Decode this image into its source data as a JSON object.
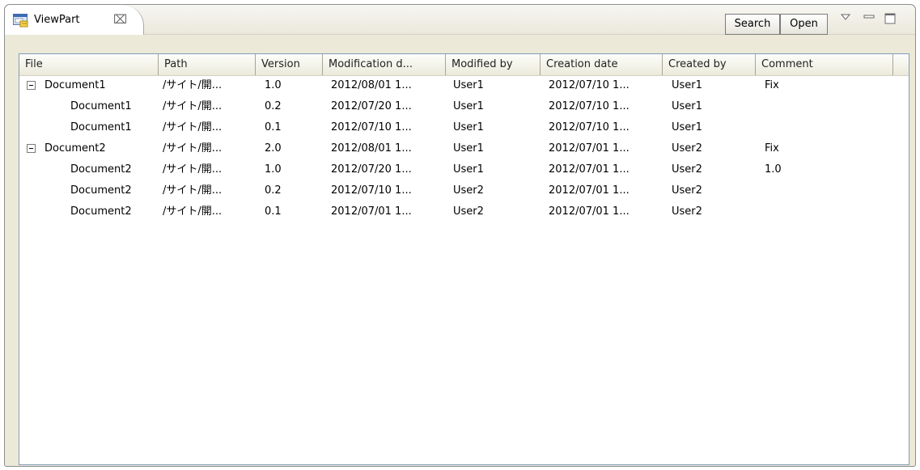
{
  "view": {
    "tab_title": "ViewPart",
    "tab_close_glyph": "⌧",
    "tab_icon": "view-icon",
    "buttons": {
      "search": "Search",
      "open": "Open"
    },
    "controls": [
      "view-menu-icon",
      "minimize-icon",
      "maximize-icon"
    ]
  },
  "table": {
    "columns": [
      "File",
      "Path",
      "Version",
      "Modification d...",
      "Modified by",
      "Creation date",
      "Created by",
      "Comment"
    ],
    "rows": [
      {
        "file": "Document1",
        "path": "/サイト/開...",
        "version": "1.0",
        "modified": "2012/08/01 1...",
        "modified_by": "User1",
        "created": "2012/07/10 1...",
        "created_by": "User1",
        "comment": "Fix",
        "parent": true
      },
      {
        "file": "Document1",
        "path": "/サイト/開...",
        "version": "0.2",
        "modified": "2012/07/20 1...",
        "modified_by": "User1",
        "created": "2012/07/10 1...",
        "created_by": "User1",
        "comment": "",
        "parent": false
      },
      {
        "file": "Document1",
        "path": "/サイト/開...",
        "version": "0.1",
        "modified": "2012/07/10 1...",
        "modified_by": "User1",
        "created": "2012/07/10 1...",
        "created_by": "User1",
        "comment": "",
        "parent": false
      },
      {
        "file": "Document2",
        "path": "/サイト/開...",
        "version": "2.0",
        "modified": "2012/08/01 1...",
        "modified_by": "User1",
        "created": "2012/07/01 1...",
        "created_by": "User2",
        "comment": "Fix",
        "parent": true
      },
      {
        "file": "Document2",
        "path": "/サイト/開...",
        "version": "1.0",
        "modified": "2012/07/20 1...",
        "modified_by": "User1",
        "created": "2012/07/01 1...",
        "created_by": "User2",
        "comment": "1.0",
        "parent": false
      },
      {
        "file": "Document2",
        "path": "/サイト/開...",
        "version": "0.2",
        "modified": "2012/07/10 1...",
        "modified_by": "User2",
        "created": "2012/07/01 1...",
        "created_by": "User2",
        "comment": "",
        "parent": false
      },
      {
        "file": "Document2",
        "path": "/サイト/開...",
        "version": "0.1",
        "modified": "2012/07/01 1...",
        "modified_by": "User2",
        "created": "2012/07/01 1...",
        "created_by": "User2",
        "comment": "",
        "parent": false
      }
    ]
  },
  "colors": {
    "frame_border": "#8c8c8c",
    "table_border": "#7f9db9",
    "background": "#ece9d8"
  }
}
